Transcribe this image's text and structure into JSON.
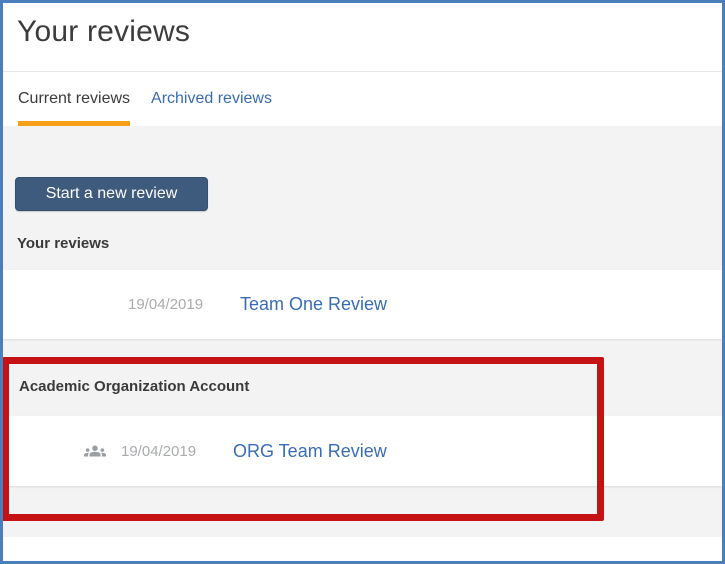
{
  "page": {
    "title": "Your reviews"
  },
  "tabs": {
    "current": {
      "label": "Current reviews",
      "active": true
    },
    "archived": {
      "label": "Archived reviews",
      "active": false
    }
  },
  "actions": {
    "start_review": "Start a new review"
  },
  "sections": [
    {
      "heading": "Your reviews",
      "rows": [
        {
          "date": "19/04/2019",
          "title": "Team One Review"
        }
      ]
    },
    {
      "heading": "Academic Organization Account",
      "highlighted": true,
      "rows": [
        {
          "date": "19/04/2019",
          "title": "ORG Team Review",
          "icon": "group-icon"
        }
      ]
    }
  ],
  "annotation": {
    "type": "highlight-box",
    "color": "#c41215"
  },
  "colors": {
    "outer_border": "#4a7ebd",
    "active_tab_underline": "#f5a018",
    "link_blue": "#3a6cb4",
    "button_bg": "#3e5a7c",
    "date_gray": "#a9abad",
    "content_bg": "#f3f3f4",
    "highlight_red": "#c41215"
  }
}
